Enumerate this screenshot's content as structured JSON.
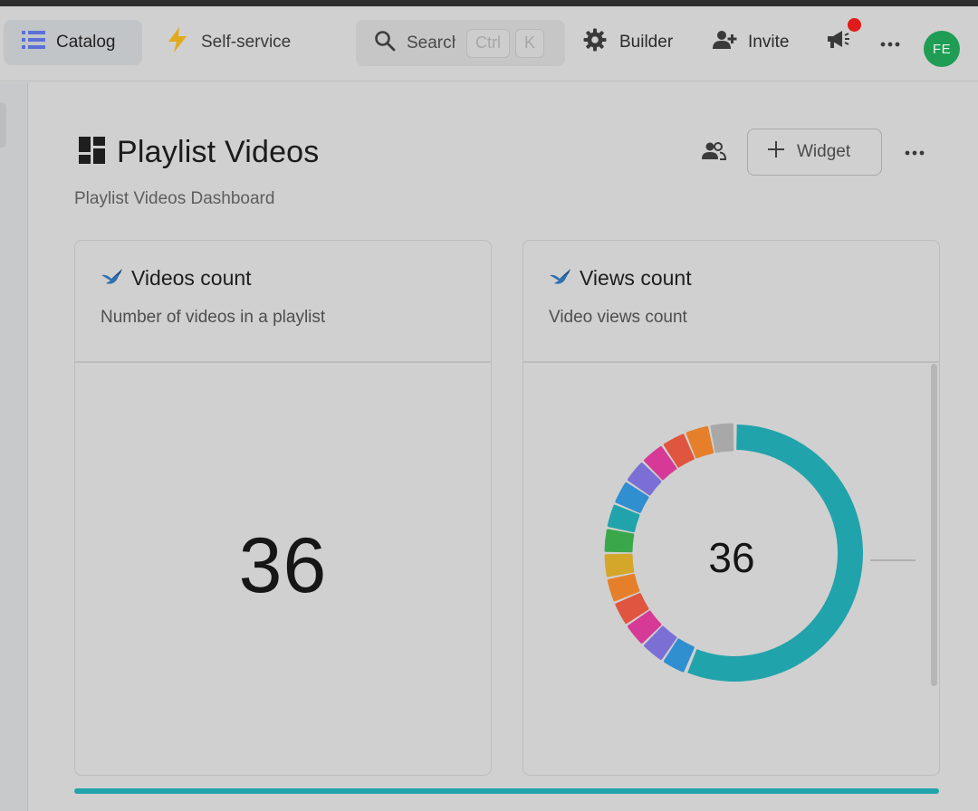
{
  "nav": {
    "catalog": "Catalog",
    "self_service": "Self-service",
    "search_placeholder": "Search",
    "search_shortcut_ctrl": "Ctrl",
    "search_shortcut_k": "K",
    "builder": "Builder",
    "invite": "Invite",
    "avatar_initials": "FE"
  },
  "page": {
    "title": "Playlist Videos",
    "subtitle": "Playlist Videos Dashboard",
    "widget_button": "Widget"
  },
  "cards": [
    {
      "title": "Videos count",
      "description": "Number of videos in a playlist",
      "value": "36"
    },
    {
      "title": "Views count",
      "description": "Video views count",
      "value": "36"
    }
  ],
  "chart_data": {
    "type": "pie",
    "center_label": "36",
    "slices": [
      {
        "value": 18,
        "color": "#21a3ab"
      },
      {
        "value": 1,
        "color": "#2f8fd0"
      },
      {
        "value": 1,
        "color": "#7b6fd6"
      },
      {
        "value": 1,
        "color": "#d63a96"
      },
      {
        "value": 1,
        "color": "#e0553f"
      },
      {
        "value": 1,
        "color": "#e67f2a"
      },
      {
        "value": 1,
        "color": "#d4a62a"
      },
      {
        "value": 1,
        "color": "#3aa84a"
      },
      {
        "value": 1,
        "color": "#21a3ab"
      },
      {
        "value": 1,
        "color": "#2f8fd0"
      },
      {
        "value": 1,
        "color": "#7b6fd6"
      },
      {
        "value": 1,
        "color": "#d63a96"
      },
      {
        "value": 1,
        "color": "#e0553f"
      },
      {
        "value": 1,
        "color": "#e67f2a"
      },
      {
        "value": 1,
        "color": "#a8a8a8"
      }
    ]
  },
  "colors": {
    "accent_teal": "#21a3ab",
    "avatar_green": "#1f9d55",
    "notification_red": "#e01b1b",
    "bolt_yellow": "#e2a91b",
    "catalog_icon": "#5a6fd6"
  }
}
